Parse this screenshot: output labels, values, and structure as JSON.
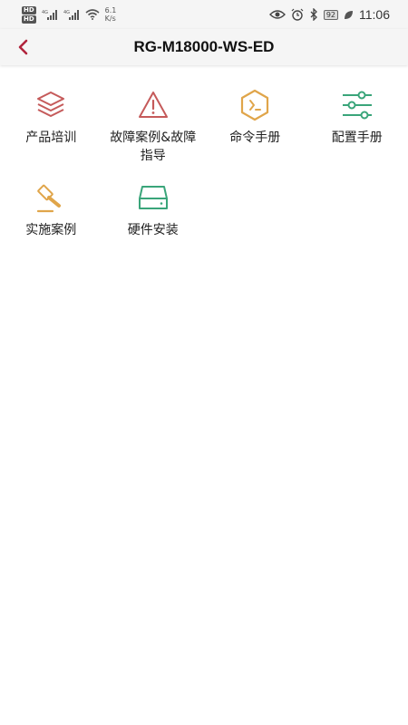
{
  "status_bar": {
    "hd1": "HD",
    "hd2": "HD",
    "net_speed_value": "6.1",
    "net_speed_unit": "K/s",
    "battery": "92",
    "time": "11:06"
  },
  "header": {
    "title": "RG-M18000-WS-ED"
  },
  "colors": {
    "accent_red": "#b0243c",
    "icon_red": "#c55a5a",
    "icon_orange": "#e0a54a",
    "icon_green": "#3aa57a"
  },
  "grid": {
    "items": [
      {
        "label": "产品培训",
        "icon": "layers-icon"
      },
      {
        "label": "故障案例&故障指导",
        "icon": "warning-triangle-icon"
      },
      {
        "label": "命令手册",
        "icon": "terminal-hexagon-icon"
      },
      {
        "label": "配置手册",
        "icon": "sliders-icon"
      },
      {
        "label": "实施案例",
        "icon": "gavel-icon"
      },
      {
        "label": "硬件安装",
        "icon": "hard-drive-icon"
      }
    ]
  }
}
